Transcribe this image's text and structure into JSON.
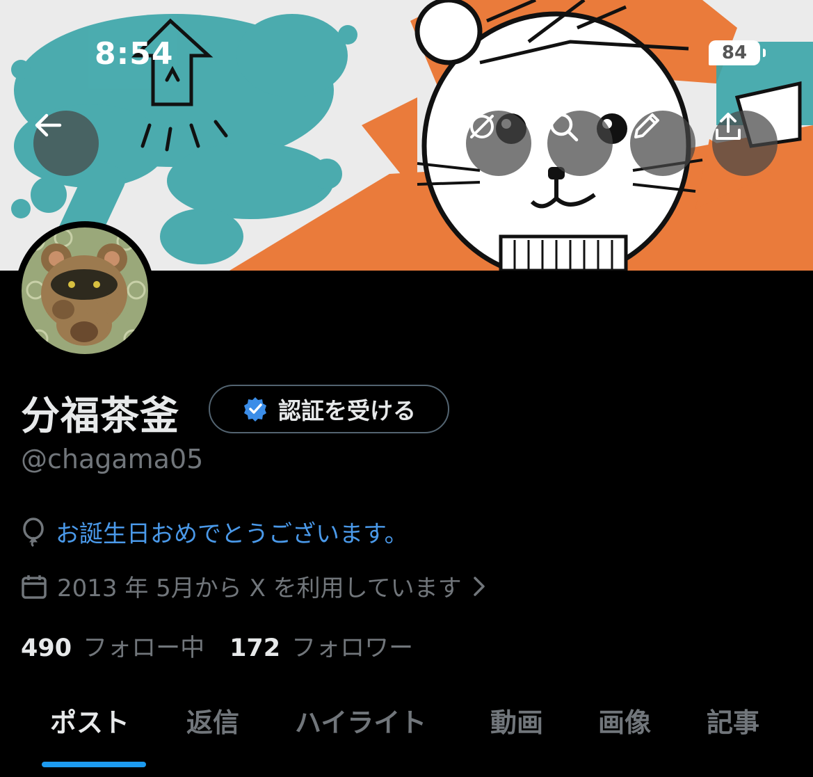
{
  "status_bar": {
    "time": "8:54",
    "battery": "84"
  },
  "header": {
    "back_icon": "arrow-left-icon",
    "actions": [
      "grok-icon",
      "search-icon",
      "pencil-icon",
      "share-icon"
    ]
  },
  "profile": {
    "name": "分福茶釜",
    "verify_button": "認証を受ける",
    "handle": "@chagama05",
    "birthday": "お誕生日おめでとうございます。",
    "joined": "2013 年 5月から X を利用しています",
    "following_count": "490",
    "following_label": "フォロー中",
    "followers_count": "172",
    "followers_label": "フォロワー"
  },
  "tabs": [
    "ポスト",
    "返信",
    "ハイライト",
    "動画",
    "画像",
    "記事"
  ],
  "active_tab": "ポスト",
  "colors": {
    "accent": "#1d9bf0",
    "link": "#4a99e9",
    "muted": "#71767b",
    "background": "#000000"
  }
}
